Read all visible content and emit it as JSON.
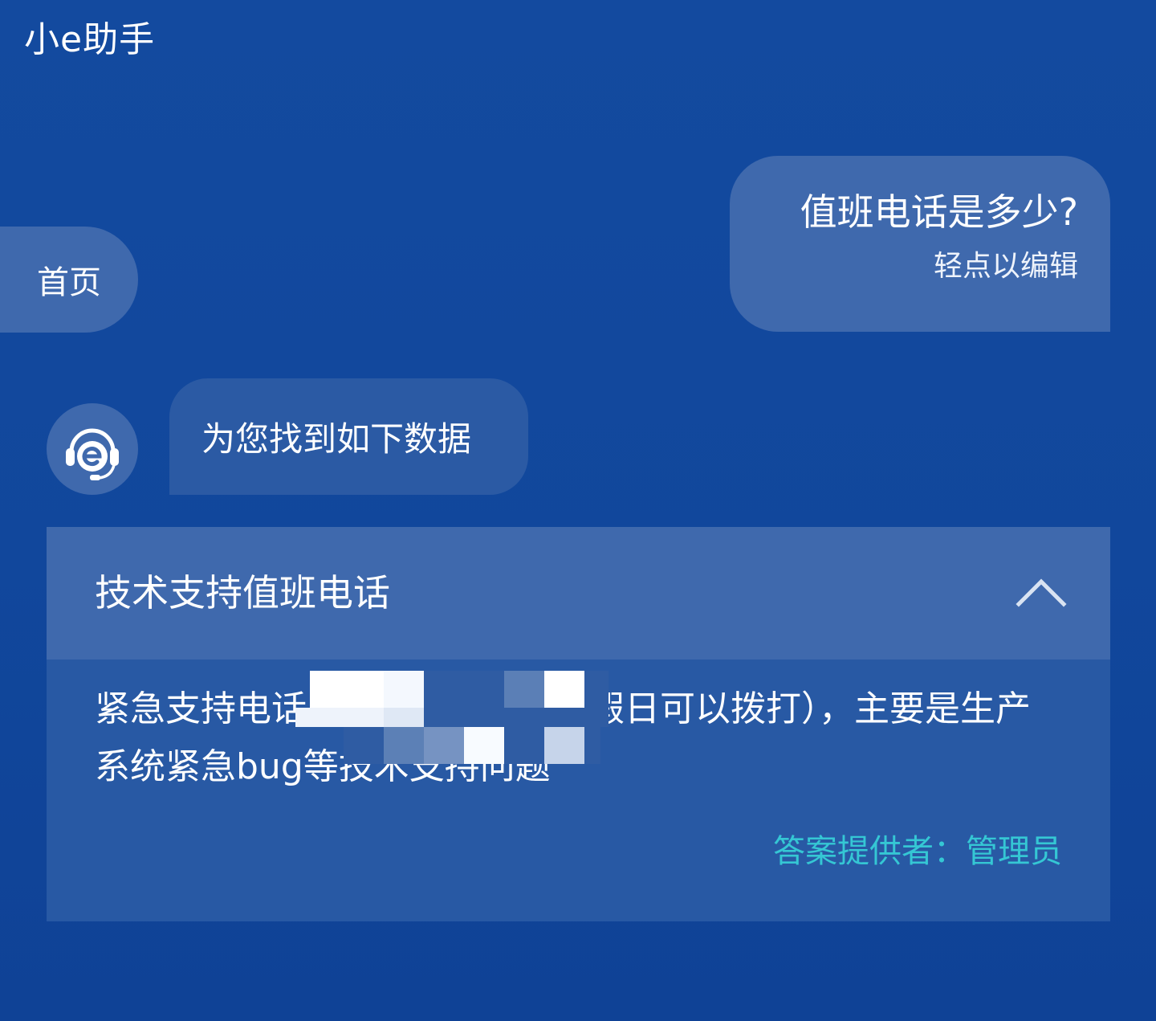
{
  "app": {
    "title": "小e助手"
  },
  "nav": {
    "home_label": "首页"
  },
  "chat": {
    "user_message": {
      "text": "值班电话是多少?",
      "edit_hint": "轻点以编辑"
    },
    "bot_message": {
      "text": "为您找到如下数据"
    }
  },
  "result_card": {
    "title": "技术支持值班电话",
    "expanded": true,
    "answer": "紧急支持电话（非工作时间及节假日可以拨打），主要是生产系统紧急bug等技术支持问题",
    "provider_label": "答案提供者：",
    "provider_name": "管理员"
  },
  "colors": {
    "background": "#134a9f",
    "bubble_light": "#3f69ad",
    "bubble_dark": "#2b5aa4",
    "card_body": "#2859a4",
    "provider_accent": "#35c7d4"
  },
  "icons": {
    "avatar": "headset-e-logo-icon",
    "collapse": "chevron-up-icon"
  }
}
